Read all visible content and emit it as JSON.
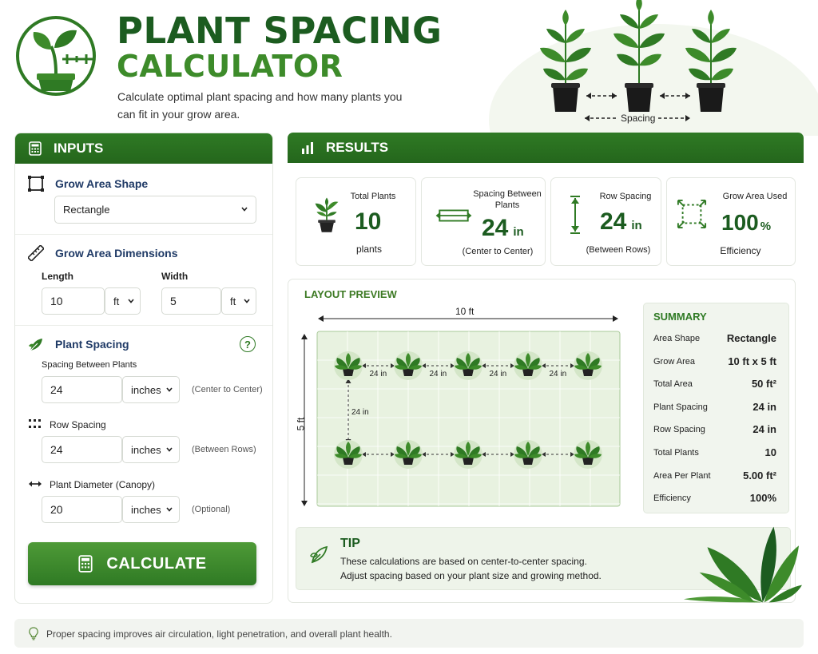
{
  "header": {
    "title_line1": "PLANT SPACING",
    "title_line2": "CALCULATOR",
    "subtitle": "Calculate optimal plant spacing and how many plants you can fit in your grow area.",
    "hero_label": "Spacing"
  },
  "inputs": {
    "panel_title": "INPUTS",
    "shape": {
      "label": "Grow Area Shape",
      "value": "Rectangle"
    },
    "dimensions": {
      "label": "Grow Area Dimensions",
      "length_label": "Length",
      "length_value": "10",
      "length_unit": "ft",
      "width_label": "Width",
      "width_value": "5",
      "width_unit": "ft"
    },
    "spacing": {
      "label": "Plant Spacing",
      "help_glyph": "?",
      "between_label": "Spacing Between Plants",
      "between_value": "24",
      "between_unit": "inches",
      "between_hint": "(Center to Center)",
      "row_label": "Row Spacing",
      "row_value": "24",
      "row_unit": "inches",
      "row_hint": "(Between Rows)",
      "diameter_label": "Plant Diameter (Canopy)",
      "diameter_value": "20",
      "diameter_unit": "inches",
      "diameter_hint": "(Optional)"
    },
    "calculate_label": "CALCULATE"
  },
  "results": {
    "panel_title": "RESULTS",
    "cards": [
      {
        "title": "Total Plants",
        "value": "10",
        "unit": "",
        "sub": "plants",
        "icon": "potted-plant-icon"
      },
      {
        "title": "Spacing Between Plants",
        "value": "24",
        "unit": "in",
        "sub": "(Center to Center)",
        "icon": "horizontal-arrow-icon"
      },
      {
        "title": "Row Spacing",
        "value": "24",
        "unit": "in",
        "sub": "(Between Rows)",
        "icon": "vertical-arrow-icon"
      },
      {
        "title": "Grow Area Used",
        "value": "100",
        "unit": "%",
        "sub": "Efficiency",
        "icon": "area-expand-icon"
      }
    ]
  },
  "layout_preview": {
    "title": "LAYOUT PREVIEW",
    "width_label": "10 ft",
    "height_label": "5 ft",
    "spacing_label": "24 in",
    "row_spacing_label": "24 in",
    "plants_per_row": 5,
    "rows": 2
  },
  "summary": {
    "title": "SUMMARY",
    "rows": [
      {
        "label": "Area Shape",
        "value": "Rectangle"
      },
      {
        "label": "Grow Area",
        "value": "10 ft x 5 ft"
      },
      {
        "label": "Total Area",
        "value": "50 ft²"
      },
      {
        "label": "Plant Spacing",
        "value": "24 in"
      },
      {
        "label": "Row Spacing",
        "value": "24 in"
      },
      {
        "label": "Total Plants",
        "value": "10"
      },
      {
        "label": "Area Per Plant",
        "value": "5.00 ft²"
      },
      {
        "label": "Efficiency",
        "value": "100%"
      }
    ]
  },
  "tip": {
    "title": "TIP",
    "line1": "These calculations are based on center-to-center spacing.",
    "line2": "Adjust spacing based on your plant size and growing method."
  },
  "footer": {
    "text": "Proper spacing improves air circulation, light penetration, and overall plant health."
  },
  "colors": {
    "primary": "#2f7a24",
    "dark_green": "#1c5c20",
    "accent_green": "#3d8b2a",
    "label_blue": "#1f3a66"
  }
}
